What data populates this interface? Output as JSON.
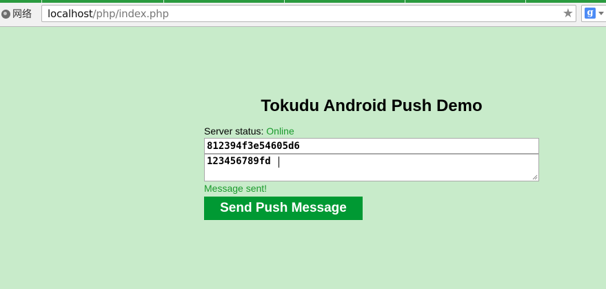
{
  "browser": {
    "site_info_label": "网络",
    "url_host": "localhost",
    "url_path": "/php/index.php",
    "star_glyph": "★",
    "search_engine_glyph": "g"
  },
  "page": {
    "title": "Tokudu Android Push Demo",
    "server_status_label": "Server status:",
    "server_status_value": "Online",
    "registration_id_value": "812394f3e54605d6",
    "message_value": "123456789fd",
    "result_text": "Message sent!",
    "send_button_label": "Send Push Message"
  },
  "colors": {
    "page_background": "#c8ebca",
    "accent_green": "#009933",
    "status_green": "#1a9a2c"
  }
}
